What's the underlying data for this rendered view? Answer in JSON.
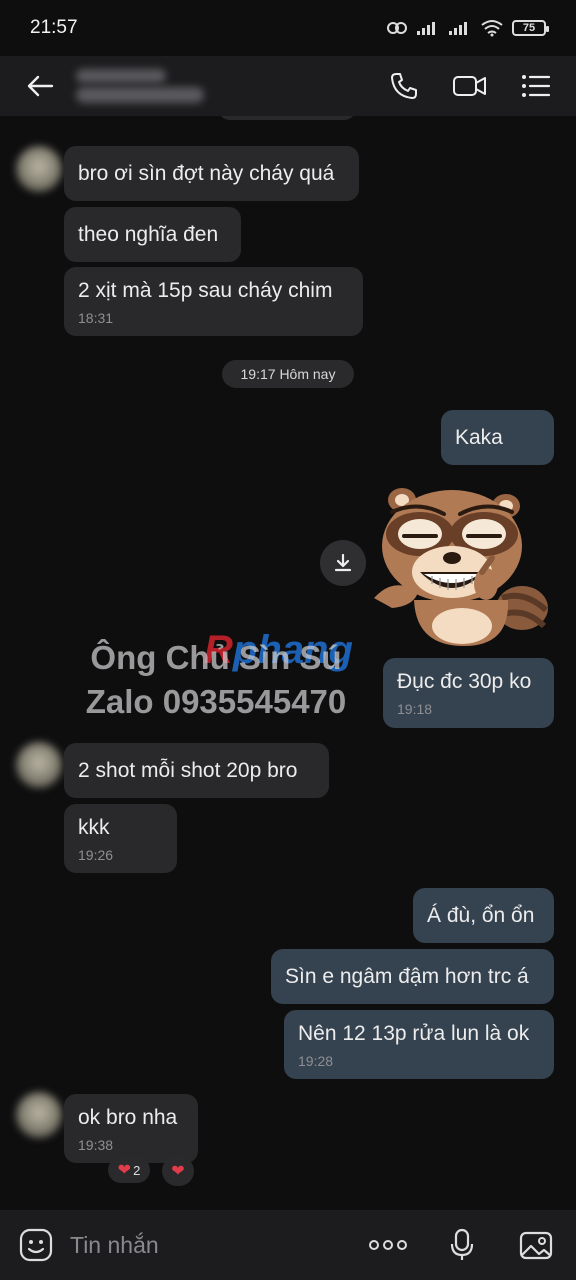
{
  "status_bar": {
    "time": "21:57",
    "battery": "75"
  },
  "header": {
    "contact_name": ""
  },
  "conversation": {
    "incoming_1": [
      {
        "text": "bro ơi sìn đợt này cháy quá",
        "time": ""
      },
      {
        "text": "theo nghĩa đen",
        "time": ""
      },
      {
        "text": "2 xịt mà 15p sau cháy chim",
        "time": "18:31"
      }
    ],
    "date_divider": "19:17 Hôm nay",
    "outgoing_1": {
      "text": "Kaka"
    },
    "outgoing_2": {
      "text": "Đục đc 30p ko",
      "time": "19:18"
    },
    "incoming_2": [
      {
        "text": "2 shot mỗi shot 20p bro",
        "time": ""
      },
      {
        "text": "kkk",
        "time": "19:26"
      }
    ],
    "outgoing_3": [
      {
        "text": "Á đù, ổn ổn",
        "time": ""
      },
      {
        "text": "Sìn e ngâm đậm hơn trc á",
        "time": ""
      },
      {
        "text": "Nên 12 13p rửa lun là ok",
        "time": "19:28"
      }
    ],
    "incoming_3": {
      "text": "ok bro nha",
      "time": "19:38"
    },
    "reactions": {
      "count": "2"
    }
  },
  "watermark": {
    "logo_prefix": "R",
    "logo_rest": "phang",
    "line1": "Ông Chủ Sìn Sú",
    "line2": "Zalo 0935545470"
  },
  "composer": {
    "placeholder": "Tin nhắn"
  },
  "icons": {
    "back": "arrow-left-icon",
    "call": "phone-icon",
    "video": "video-call-icon",
    "menu": "menu-list-icon",
    "download": "download-icon",
    "sticker": "raccoon-sticker",
    "emoji": "emoji-icon",
    "more": "more-dots-icon",
    "mic": "microphone-icon",
    "image": "image-icon"
  },
  "colors": {
    "background": "#0e0e0f",
    "incoming_bubble": "#29292b",
    "outgoing_bubble": "#35424f",
    "reaction_heart": "#e23b4a"
  }
}
